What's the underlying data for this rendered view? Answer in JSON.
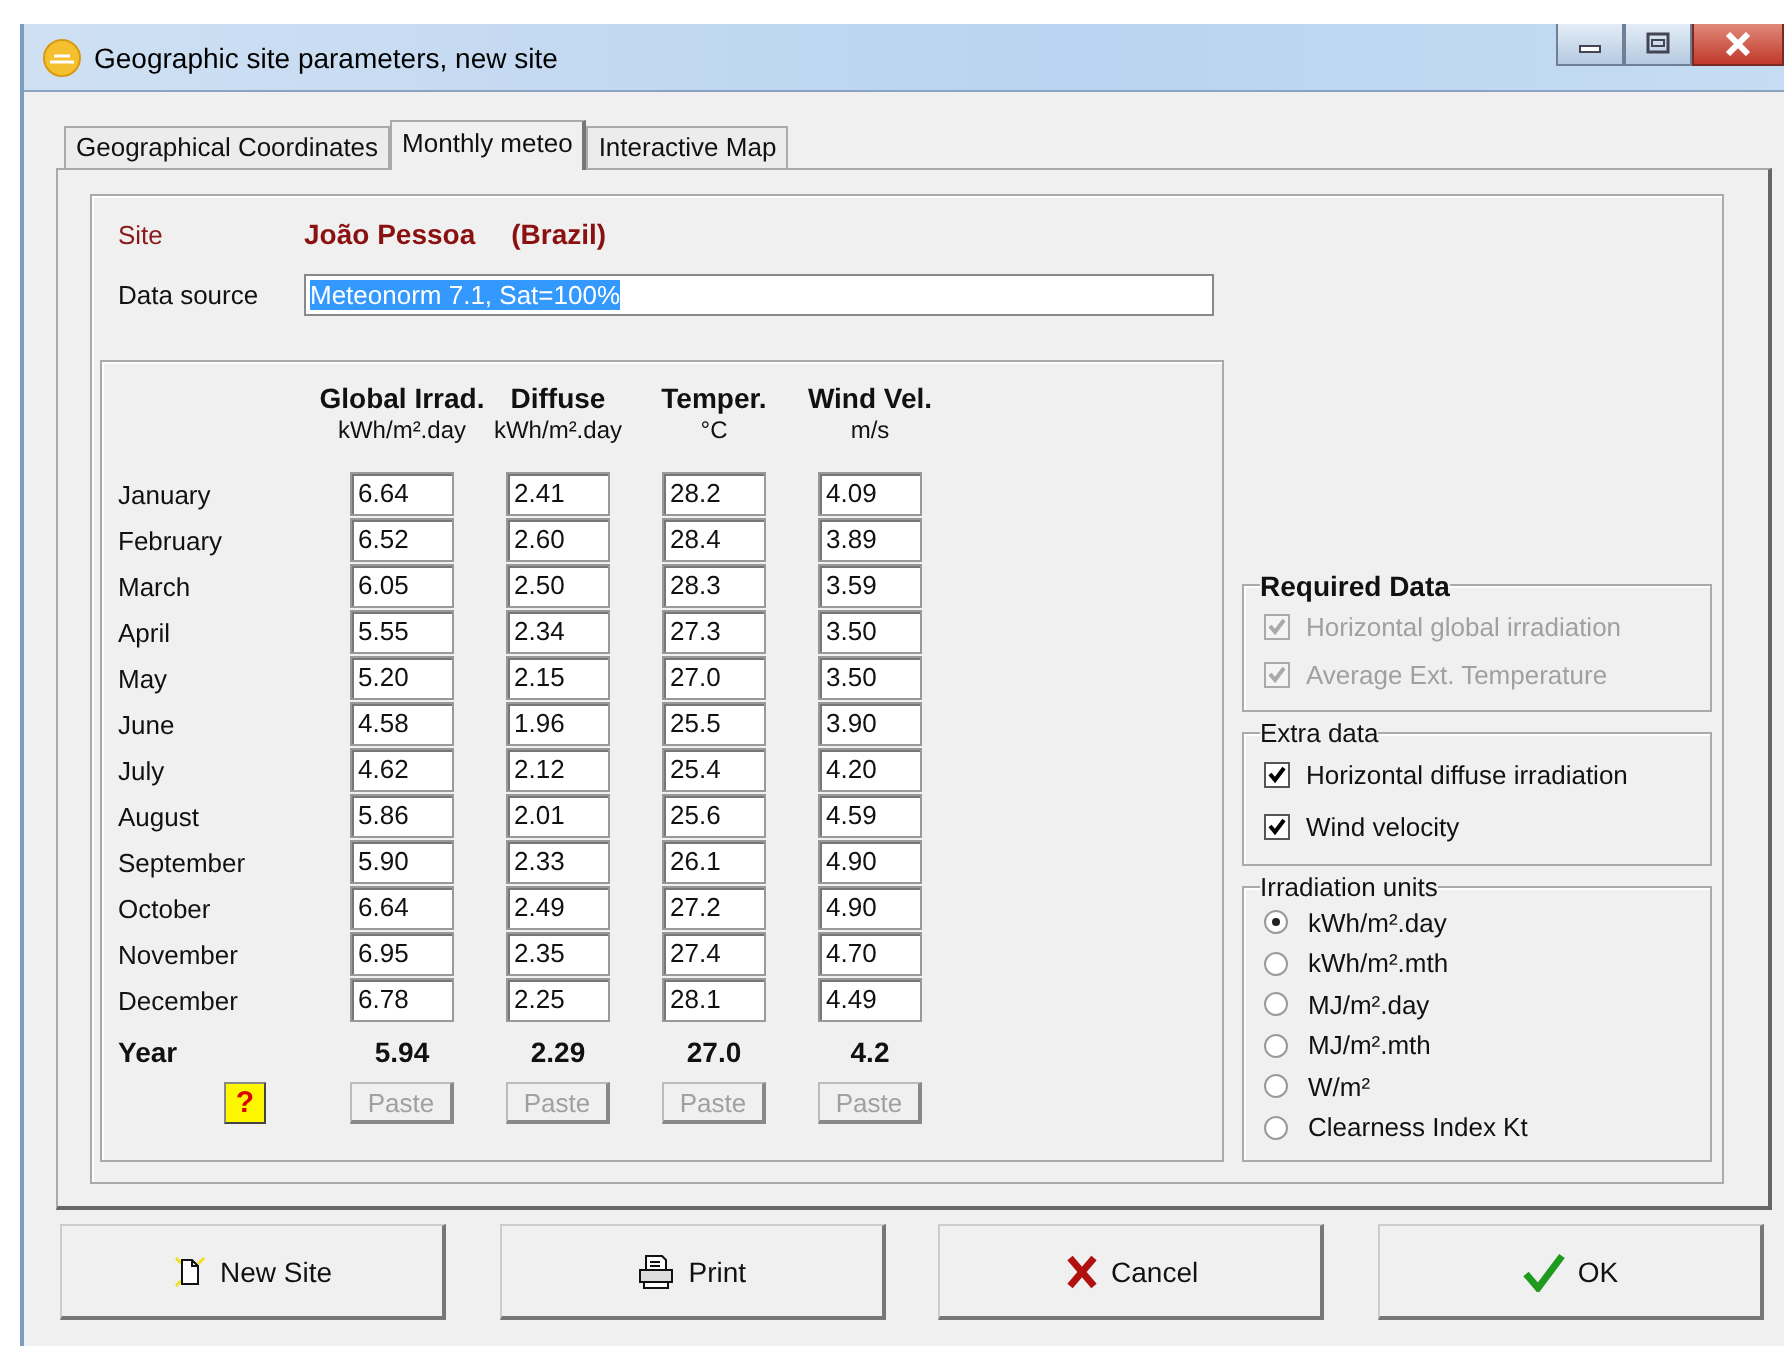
{
  "window": {
    "title": "Geographic site parameters, new site"
  },
  "tabs": [
    {
      "label": "Geographical Coordinates",
      "selected": false
    },
    {
      "label": "Monthly meteo",
      "selected": true
    },
    {
      "label": "Interactive Map",
      "selected": false
    }
  ],
  "site": {
    "label": "Site",
    "name": "João Pessoa",
    "country": "(Brazil)"
  },
  "data_source": {
    "label": "Data source",
    "value": "Meteonorm 7.1, Sat=100%"
  },
  "table": {
    "columns": [
      {
        "title": "Global Irrad.",
        "unit": "kWh/m².day"
      },
      {
        "title": "Diffuse",
        "unit": "kWh/m².day"
      },
      {
        "title": "Temper.",
        "unit": "°C"
      },
      {
        "title": "Wind Vel.",
        "unit": "m/s"
      }
    ],
    "rows": [
      {
        "month": "January",
        "values": [
          "6.64",
          "2.41",
          "28.2",
          "4.09"
        ]
      },
      {
        "month": "February",
        "values": [
          "6.52",
          "2.60",
          "28.4",
          "3.89"
        ]
      },
      {
        "month": "March",
        "values": [
          "6.05",
          "2.50",
          "28.3",
          "3.59"
        ]
      },
      {
        "month": "April",
        "values": [
          "5.55",
          "2.34",
          "27.3",
          "3.50"
        ]
      },
      {
        "month": "May",
        "values": [
          "5.20",
          "2.15",
          "27.0",
          "3.50"
        ]
      },
      {
        "month": "June",
        "values": [
          "4.58",
          "1.96",
          "25.5",
          "3.90"
        ]
      },
      {
        "month": "July",
        "values": [
          "4.62",
          "2.12",
          "25.4",
          "4.20"
        ]
      },
      {
        "month": "August",
        "values": [
          "5.86",
          "2.01",
          "25.6",
          "4.59"
        ]
      },
      {
        "month": "September",
        "values": [
          "5.90",
          "2.33",
          "26.1",
          "4.90"
        ]
      },
      {
        "month": "October",
        "values": [
          "6.64",
          "2.49",
          "27.2",
          "4.90"
        ]
      },
      {
        "month": "November",
        "values": [
          "6.95",
          "2.35",
          "27.4",
          "4.70"
        ]
      },
      {
        "month": "December",
        "values": [
          "6.78",
          "2.25",
          "28.1",
          "4.49"
        ]
      }
    ],
    "year": {
      "label": "Year",
      "values": [
        "5.94",
        "2.29",
        "27.0",
        "4.2"
      ]
    },
    "help_button": {
      "label": "?"
    },
    "paste_buttons": [
      {
        "label": "Paste",
        "disabled": true
      },
      {
        "label": "Paste",
        "disabled": true
      },
      {
        "label": "Paste",
        "disabled": true
      },
      {
        "label": "Paste",
        "disabled": true
      }
    ]
  },
  "required_data": {
    "title": "Required Data",
    "items": [
      {
        "label": "Horizontal global irradiation",
        "checked": true,
        "disabled": true
      },
      {
        "label": "Average Ext. Temperature",
        "checked": true,
        "disabled": true
      }
    ]
  },
  "extra_data": {
    "title": "Extra data",
    "items": [
      {
        "label": "Horizontal diffuse irradiation",
        "checked": true,
        "disabled": false
      },
      {
        "label": "Wind velocity",
        "checked": true,
        "disabled": false
      }
    ]
  },
  "irradiation_units": {
    "title": "Irradiation units",
    "options": [
      {
        "label": "kWh/m².day",
        "selected": true
      },
      {
        "label": "kWh/m².mth",
        "selected": false
      },
      {
        "label": "MJ/m².day",
        "selected": false
      },
      {
        "label": "MJ/m².mth",
        "selected": false
      },
      {
        "label": "W/m²",
        "selected": false
      },
      {
        "label": "Clearness Index Kt",
        "selected": false
      }
    ]
  },
  "buttons": [
    {
      "label": "New Site",
      "kind": "new"
    },
    {
      "label": "Print",
      "kind": "print"
    },
    {
      "label": "Cancel",
      "kind": "cancel"
    },
    {
      "label": "OK",
      "kind": "ok"
    }
  ]
}
